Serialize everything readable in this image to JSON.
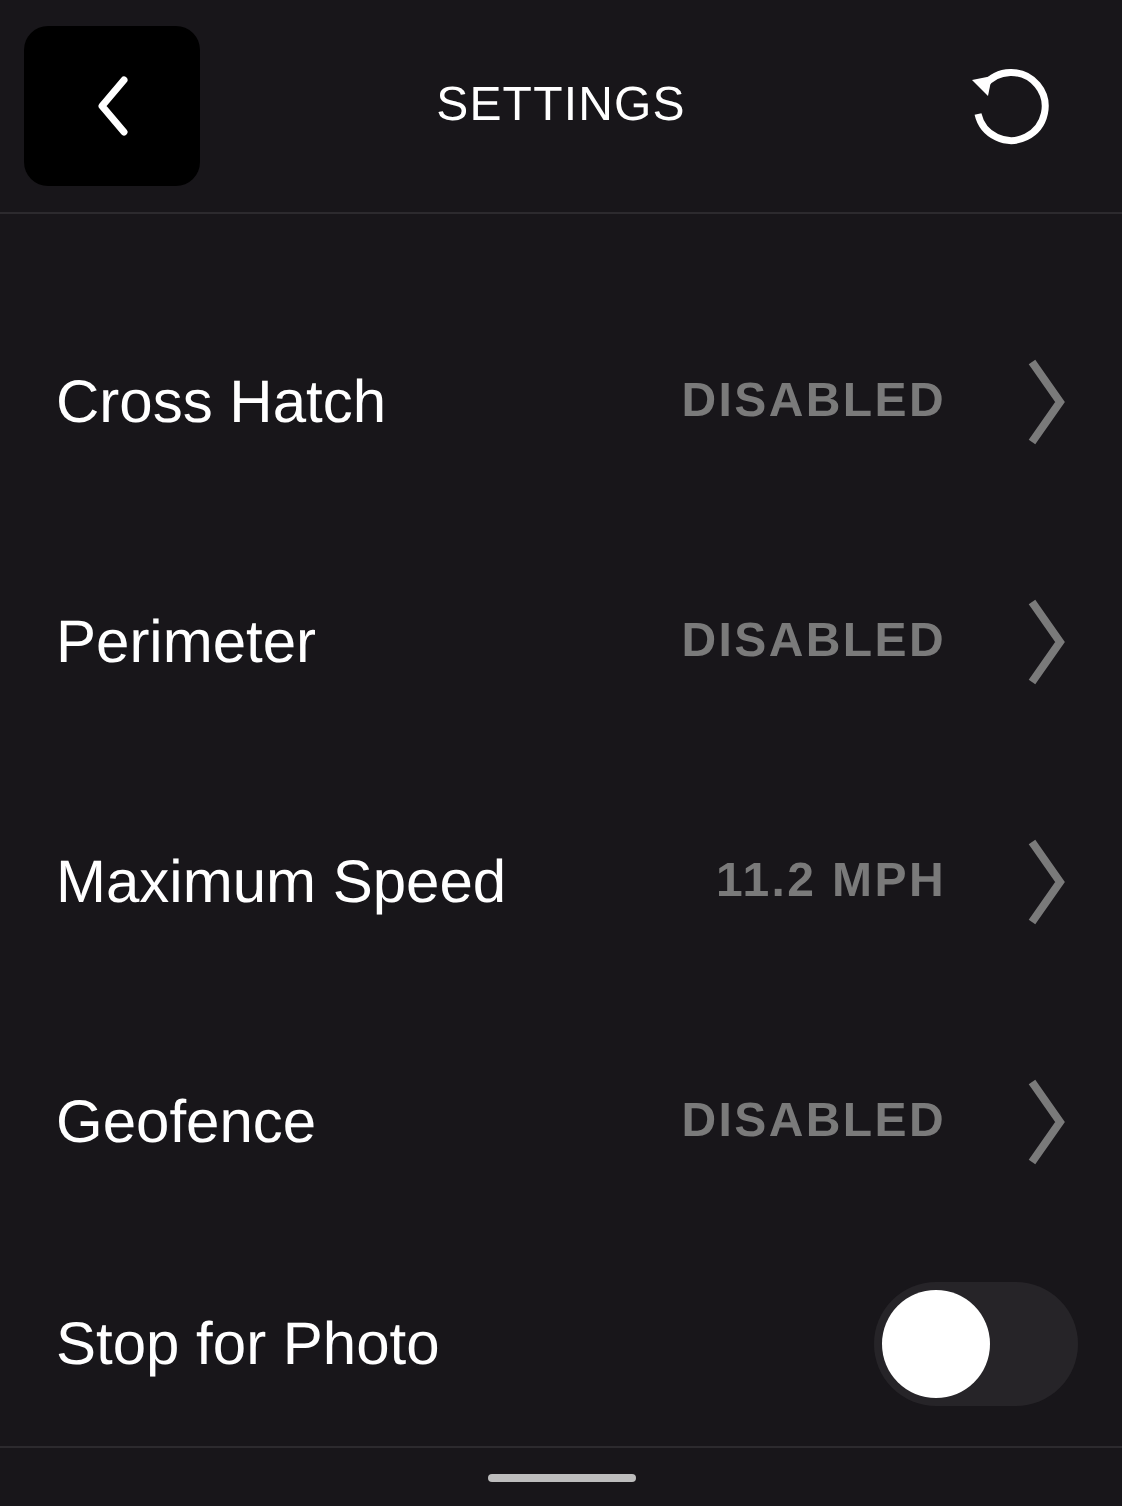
{
  "header": {
    "title": "SETTINGS"
  },
  "rows": [
    {
      "kind": "link",
      "label": "Cross Hatch",
      "value": "DISABLED"
    },
    {
      "kind": "link",
      "label": "Perimeter",
      "value": "DISABLED"
    },
    {
      "kind": "link",
      "label": "Maximum Speed",
      "value": "11.2 MPH"
    },
    {
      "kind": "link",
      "label": "Geofence",
      "value": "DISABLED"
    },
    {
      "kind": "toggle",
      "label": "Stop for Photo",
      "on": false
    }
  ]
}
